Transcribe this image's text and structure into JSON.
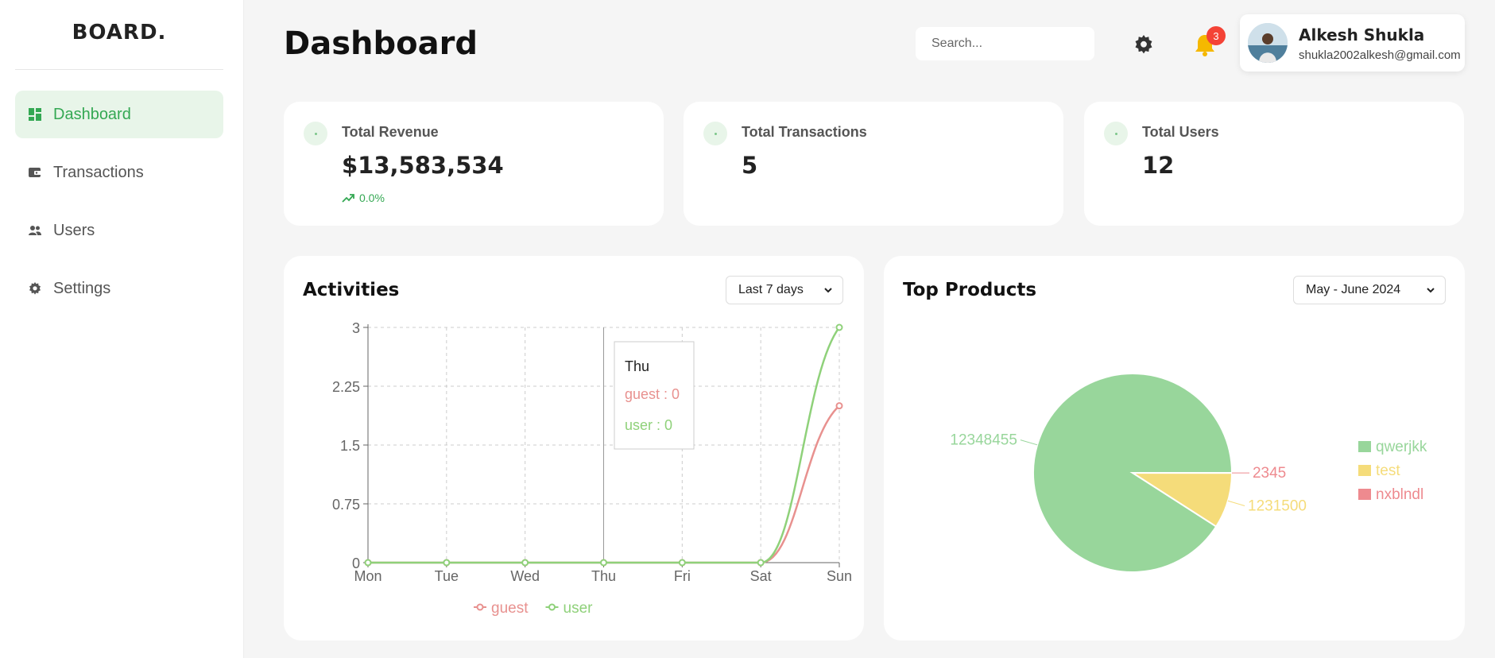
{
  "sidebar": {
    "logo": "BOARD.",
    "items": [
      {
        "label": "Dashboard",
        "icon": "dashboard-icon",
        "active": true
      },
      {
        "label": "Transactions",
        "icon": "wallet-icon",
        "active": false
      },
      {
        "label": "Users",
        "icon": "users-icon",
        "active": false
      },
      {
        "label": "Settings",
        "icon": "gear-icon",
        "active": false
      }
    ]
  },
  "header": {
    "title": "Dashboard",
    "search_placeholder": "Search...",
    "notification_count": "3",
    "profile": {
      "name": "Alkesh Shukla",
      "email": "shukla2002alkesh@gmail.com"
    }
  },
  "stats": [
    {
      "label": "Total Revenue",
      "value": "$13,583,534",
      "trend": "0.0%"
    },
    {
      "label": "Total Transactions",
      "value": "5"
    },
    {
      "label": "Total Users",
      "value": "12"
    }
  ],
  "activities": {
    "title": "Activities",
    "range": "Last 7 days",
    "tooltip": {
      "day": "Thu",
      "guest": "guest : 0",
      "user": "user : 0"
    }
  },
  "top_products": {
    "title": "Top Products",
    "range": "May - June 2024"
  },
  "colors": {
    "accent": "#34a853",
    "active_bg": "#e8f5e9",
    "guest": "#e8918f",
    "user": "#8fd17a",
    "pie_qwerjkk": "#98d69b",
    "pie_test": "#f5dc7a",
    "pie_nxblndl": "#ee8a8f"
  },
  "chart_data": [
    {
      "type": "line",
      "x": [
        "Mon",
        "Tue",
        "Wed",
        "Thu",
        "Fri",
        "Sat",
        "Sun"
      ],
      "ylim": [
        0,
        3
      ],
      "yticks": [
        "0",
        "0.75",
        "1.5",
        "2.25",
        "3"
      ],
      "series": [
        {
          "name": "guest",
          "values": [
            0,
            0,
            0,
            0,
            0,
            0,
            2
          ]
        },
        {
          "name": "user",
          "values": [
            0,
            0,
            0,
            0,
            0,
            0,
            3
          ]
        }
      ],
      "grid": true,
      "legend": "bottom"
    },
    {
      "type": "pie",
      "categories": [
        "qwerjkk",
        "test",
        "nxblndl"
      ],
      "values": [
        12348455,
        1231500,
        2345
      ],
      "labels": [
        "12348455",
        "1231500",
        "2345"
      ],
      "legend": "right"
    }
  ]
}
